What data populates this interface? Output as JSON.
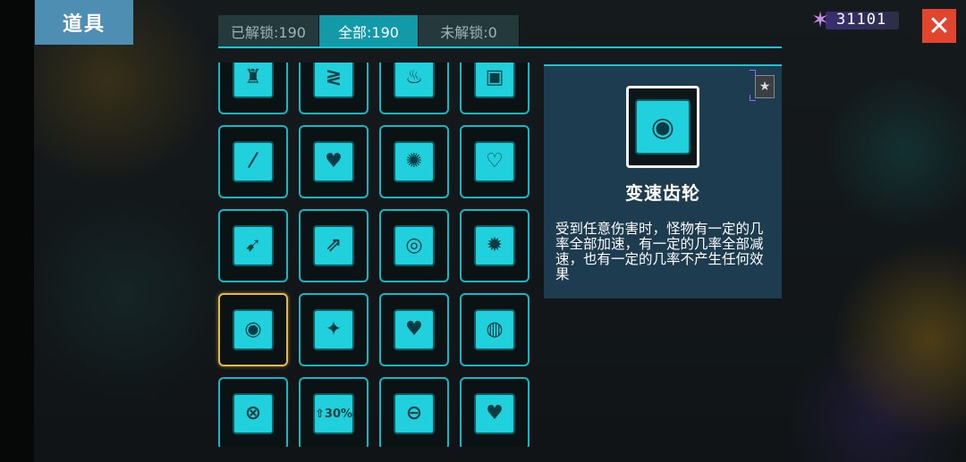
{
  "header": {
    "title": "道具"
  },
  "tabs": [
    {
      "label": "已解锁:190",
      "active": false
    },
    {
      "label": "全部:190",
      "active": true
    },
    {
      "label": "未解锁:0",
      "active": false
    }
  ],
  "currency": {
    "value": "31101",
    "icon": "crystal-star-icon"
  },
  "close_icon": "close-icon",
  "items": [
    {
      "icon": "chess-piece-icon",
      "glyph": "♜"
    },
    {
      "icon": "zigzag-figure-icon",
      "glyph": "≷"
    },
    {
      "icon": "burning-house-icon",
      "glyph": "♨"
    },
    {
      "icon": "twin-blocks-icon",
      "glyph": "▣"
    },
    {
      "icon": "bandage-icon",
      "glyph": "⁄"
    },
    {
      "icon": "heart-icon",
      "glyph": "♥"
    },
    {
      "icon": "splash-icon",
      "glyph": "✺"
    },
    {
      "icon": "shield-heart-icon",
      "glyph": "♡"
    },
    {
      "icon": "bow-arrow-icon",
      "glyph": "➹"
    },
    {
      "icon": "missiles-icon",
      "glyph": "⇗"
    },
    {
      "icon": "target-ring-icon",
      "glyph": "◎"
    },
    {
      "icon": "burst-heart-icon",
      "glyph": "✹"
    },
    {
      "icon": "gear-clock-icon",
      "glyph": "◉"
    },
    {
      "icon": "four-point-star-icon",
      "glyph": "✦"
    },
    {
      "icon": "heart-cross-icon",
      "glyph": "♥"
    },
    {
      "icon": "ring-segment-icon",
      "glyph": "◍"
    },
    {
      "icon": "cancel-circle-icon",
      "glyph": "⊗"
    },
    {
      "icon": "arrow-up-percent-icon",
      "glyph": "⇧30%"
    },
    {
      "icon": "split-circle-icon",
      "glyph": "⊖"
    },
    {
      "icon": "broken-heart-icon",
      "glyph": "♥"
    }
  ],
  "selected_index": 12,
  "detail": {
    "name": "变速齿轮",
    "description": "受到任意伤害时，怪物有一定的几率全部加速，有一定的几率全部减速，也有一定的几率不产生任何效果",
    "icon": "gear-clock-icon",
    "glyph": "◉",
    "badge_icon": "star-badge-icon",
    "badge_glyph": "★"
  }
}
